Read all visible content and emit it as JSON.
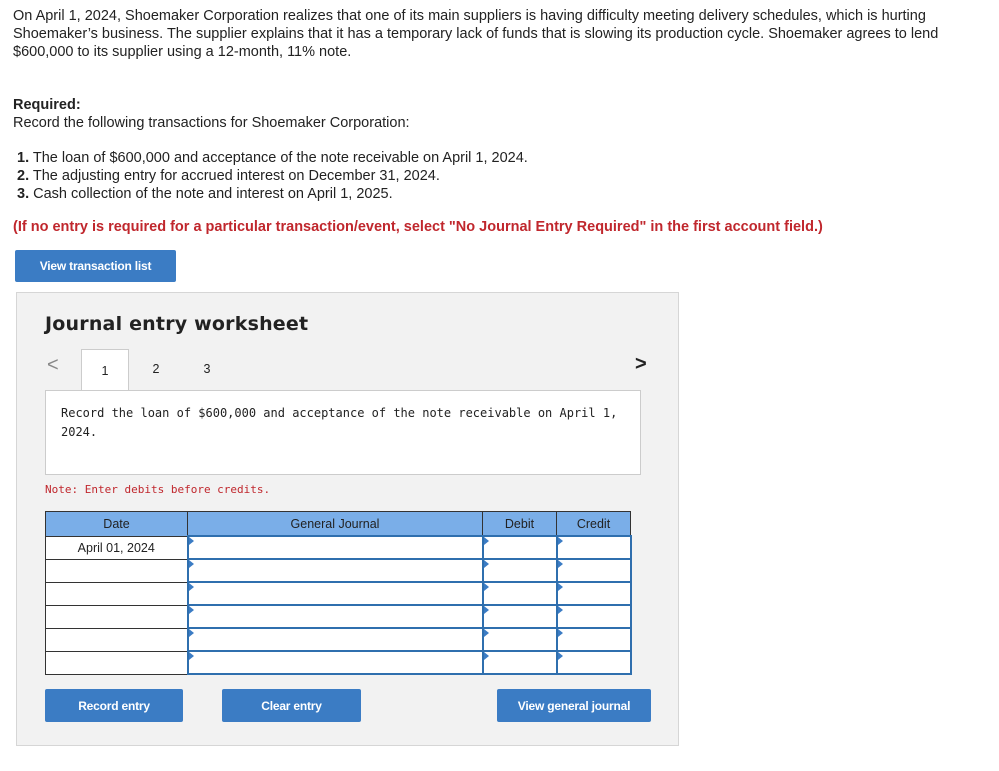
{
  "intro": "On April 1, 2024, Shoemaker Corporation realizes that one of its main suppliers is having difficulty meeting delivery schedules, which is hurting Shoemaker’s business. The supplier explains that it has a temporary lack of funds that is slowing its production cycle. Shoemaker agrees to lend $600,000 to its supplier using a 12-month, 11% note.",
  "required": {
    "heading": "Required:",
    "text": "Record the following transactions for Shoemaker Corporation:",
    "steps": [
      {
        "num": "1.",
        "text": " The loan of $600,000 and acceptance of the note receivable on April 1, 2024."
      },
      {
        "num": "2.",
        "text": " The adjusting entry for accrued interest on December 31, 2024."
      },
      {
        "num": "3.",
        "text": " Cash collection of the note and interest on April 1, 2025."
      }
    ],
    "warning": "(If no entry is required for a particular transaction/event, select \"No Journal Entry Required\" in the first account field.)"
  },
  "buttons": {
    "view_transaction_list": "View transaction list",
    "record_entry": "Record entry",
    "clear_entry": "Clear entry",
    "view_general_journal": "View general journal"
  },
  "worksheet": {
    "title": "Journal entry worksheet",
    "nav_prev": "<",
    "nav_next": ">",
    "tabs": [
      "1",
      "2",
      "3"
    ],
    "active_tab": 1,
    "description": "Record the loan of $600,000 and acceptance of the note receivable on April 1, 2024.",
    "note": "Note: Enter debits before credits.",
    "columns": [
      "Date",
      "General Journal",
      "Debit",
      "Credit"
    ],
    "rows": [
      {
        "date": "April 01, 2024",
        "account": "",
        "debit": "",
        "credit": ""
      },
      {
        "date": "",
        "account": "",
        "debit": "",
        "credit": ""
      },
      {
        "date": "",
        "account": "",
        "debit": "",
        "credit": ""
      },
      {
        "date": "",
        "account": "",
        "debit": "",
        "credit": ""
      },
      {
        "date": "",
        "account": "",
        "debit": "",
        "credit": ""
      },
      {
        "date": "",
        "account": "",
        "debit": "",
        "credit": ""
      }
    ]
  },
  "colors": {
    "button": "#3b7cc4",
    "header": "#7aaee8",
    "warning": "#c0272d"
  }
}
